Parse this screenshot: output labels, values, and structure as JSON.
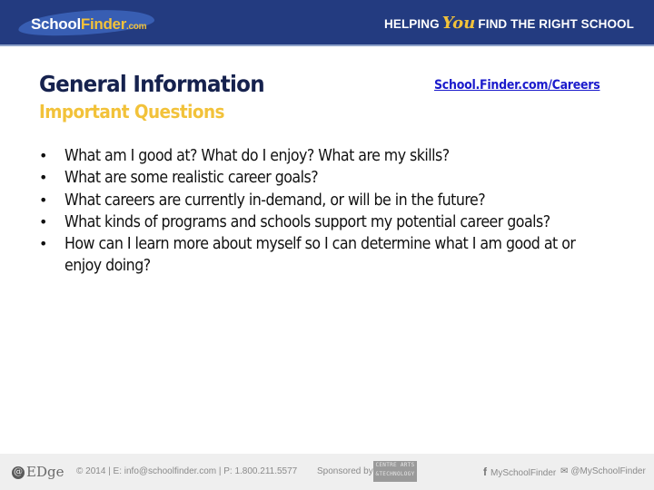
{
  "header": {
    "logo": {
      "school": "School",
      "finder": "Finder",
      "com": ".com"
    },
    "tagline": {
      "before": "HELPING",
      "you": "You",
      "after": "FIND THE RIGHT SCHOOL"
    }
  },
  "main": {
    "title": "General Information",
    "subtitle": "Important Questions",
    "link": "School.Finder.com/Careers",
    "bullet_glyph": "•",
    "questions": [
      "What am I good at? What do I enjoy? What are my skills?",
      "What are some realistic career goals?",
      "What careers are currently in-demand, or will be in the future?",
      "What kinds of programs and schools support my potential career goals?",
      "How can I learn more about myself so I can determine what I am good at or enjoy doing?"
    ]
  },
  "footer": {
    "edge_logo": "EDge",
    "contact": "© 2014 | E: info@schoolfinder.com | P: 1.800.211.5577",
    "sponsored_by": "Sponsored by",
    "sponsor_badge_line1": "CENTRE ARTS",
    "sponsor_badge_line2": "&TECHNOLOGY",
    "facebook_icon": "f",
    "facebook": "MySchoolFinder",
    "twitter_icon": "🐦",
    "twitter": "@MySchoolFinder"
  },
  "colors": {
    "header_bg": "#233b80",
    "accent_gold": "#f2c23a",
    "title_navy": "#16224e",
    "link_blue": "#1a1acc",
    "footer_bg": "#efefef"
  }
}
